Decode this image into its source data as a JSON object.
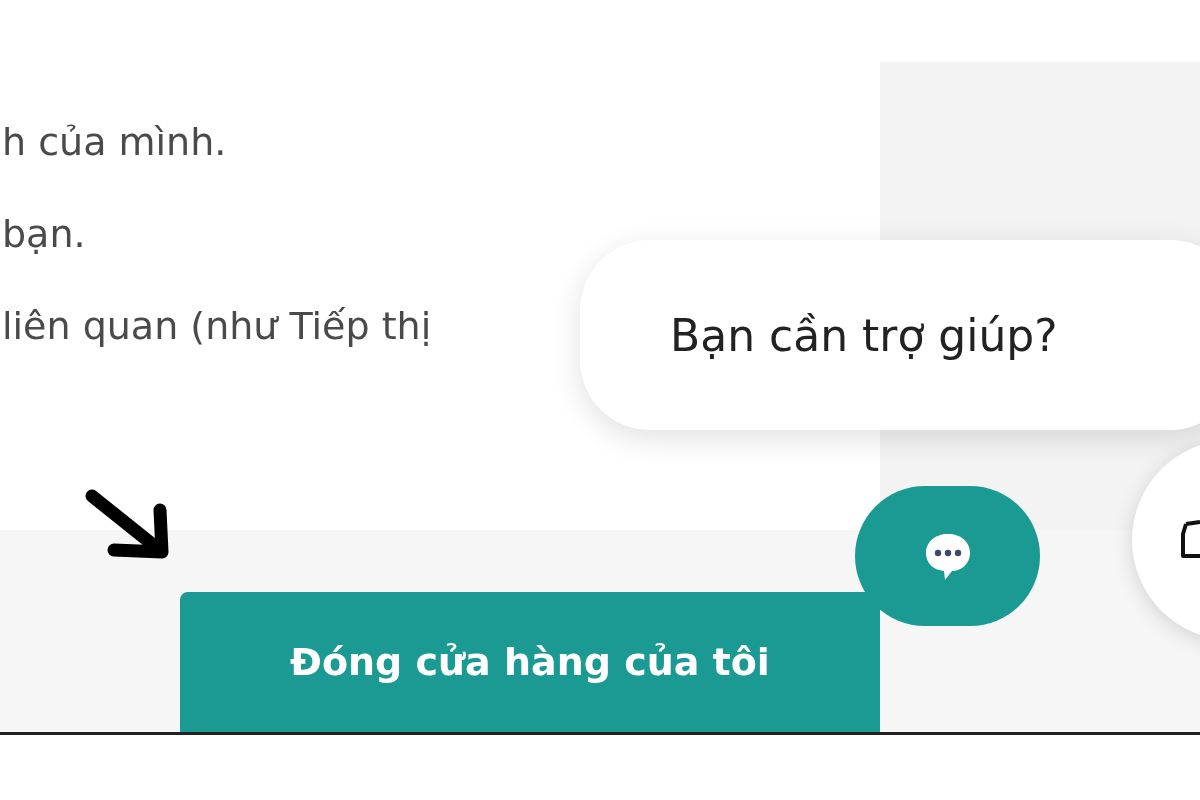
{
  "text_lines": [
    "h của mình.",
    "bạn.",
    "liên quan (như Tiếp thị"
  ],
  "help_bubble": {
    "text": "Bạn cần trợ giúp?"
  },
  "close_store_button": {
    "label": "Đóng cửa hàng của tôi"
  }
}
